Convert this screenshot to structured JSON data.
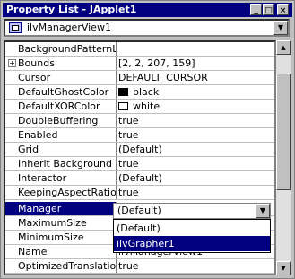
{
  "window": {
    "title": "Property List - JApplet1",
    "minimize_glyph": "_",
    "maximize_glyph": "□",
    "close_glyph": "×"
  },
  "object_combo": {
    "value": "ilvManagerView1",
    "icon": "component-icon",
    "arrow": "▼"
  },
  "properties": [
    {
      "name": "BackgroundPatternL",
      "value": ""
    },
    {
      "name": "Bounds",
      "value": "[2, 2, 207, 159]",
      "expand": "+"
    },
    {
      "name": "Cursor",
      "value": "DEFAULT_CURSOR"
    },
    {
      "name": "DefaultGhostColor",
      "value": "black",
      "swatch": "#000000"
    },
    {
      "name": "DefaultXORColor",
      "value": "white",
      "swatch": "#ffffff"
    },
    {
      "name": "DoubleBuffering",
      "value": "true"
    },
    {
      "name": "Enabled",
      "value": "true"
    },
    {
      "name": "Grid",
      "value": "(Default)"
    },
    {
      "name": "Inherit Background",
      "value": "true"
    },
    {
      "name": "Interactor",
      "value": "(Default)"
    },
    {
      "name": "KeepingAspectRatio",
      "value": "true"
    },
    {
      "name": "Manager",
      "value": ""
    },
    {
      "name": "MaximumSize",
      "value": ""
    },
    {
      "name": "MinimumSize",
      "value": ""
    },
    {
      "name": "Name",
      "value": "ilvManagerView1"
    },
    {
      "name": "OptimizedTranslation",
      "value": "true"
    }
  ],
  "manager_dropdown": {
    "selected": "(Default)",
    "arrow": "▼",
    "options": [
      "(Default)",
      "ilvGrapher1"
    ],
    "highlighted": "ilvGrapher1"
  },
  "scrollbar": {
    "up": "▲",
    "down": "▼"
  },
  "colors": {
    "title_bg": "#000080",
    "selection": "#000080",
    "face": "#c0c0c0"
  }
}
